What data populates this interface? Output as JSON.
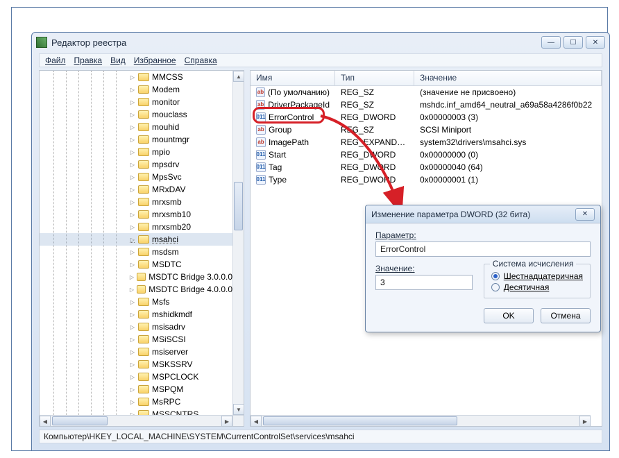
{
  "window": {
    "title": "Редактор реестра"
  },
  "menubar": {
    "file": "Файл",
    "edit": "Правка",
    "view": "Вид",
    "favorites": "Избранное",
    "help": "Справка"
  },
  "tree": [
    "MMCSS",
    "Modem",
    "monitor",
    "mouclass",
    "mouhid",
    "mountmgr",
    "mpio",
    "mpsdrv",
    "MpsSvc",
    "MRxDAV",
    "mrxsmb",
    "mrxsmb10",
    "mrxsmb20",
    "msahci",
    "msdsm",
    "MSDTC",
    "MSDTC Bridge 3.0.0.0",
    "MSDTC Bridge 4.0.0.0",
    "Msfs",
    "mshidkmdf",
    "msisadrv",
    "MSiSCSI",
    "msiserver",
    "MSKSSRV",
    "MSPCLOCK",
    "MSPQM",
    "MsRPC",
    "MSSCNTRS"
  ],
  "tree_selected_index": 13,
  "list": {
    "cols": {
      "name": "Имя",
      "type": "Тип",
      "value": "Значение"
    },
    "rows": [
      {
        "icon": "str",
        "name": "(По умолчанию)",
        "type": "REG_SZ",
        "value": "(значение не присвоено)"
      },
      {
        "icon": "str",
        "name": "DriverPackageId",
        "type": "REG_SZ",
        "value": "mshdc.inf_amd64_neutral_a69a58a4286f0b22"
      },
      {
        "icon": "bin",
        "name": "ErrorControl",
        "type": "REG_DWORD",
        "value": "0x00000003 (3)"
      },
      {
        "icon": "str",
        "name": "Group",
        "type": "REG_SZ",
        "value": "SCSI Miniport"
      },
      {
        "icon": "str",
        "name": "ImagePath",
        "type": "REG_EXPAND_SZ",
        "value": "system32\\drivers\\msahci.sys"
      },
      {
        "icon": "bin",
        "name": "Start",
        "type": "REG_DWORD",
        "value": "0x00000000 (0)"
      },
      {
        "icon": "bin",
        "name": "Tag",
        "type": "REG_DWORD",
        "value": "0x00000040 (64)"
      },
      {
        "icon": "bin",
        "name": "Type",
        "type": "REG_DWORD",
        "value": "0x00000001 (1)"
      }
    ]
  },
  "dialog": {
    "title": "Изменение параметра DWORD (32 бита)",
    "param_label": "Параметр:",
    "param_value": "ErrorControl",
    "value_label": "Значение:",
    "value_value": "3",
    "radix_label": "Система исчисления",
    "radix_hex": "Шестнадцатеричная",
    "radix_dec": "Десятичная",
    "ok": "OK",
    "cancel": "Отмена"
  },
  "statusbar": "Компьютер\\HKEY_LOCAL_MACHINE\\SYSTEM\\CurrentControlSet\\services\\msahci"
}
